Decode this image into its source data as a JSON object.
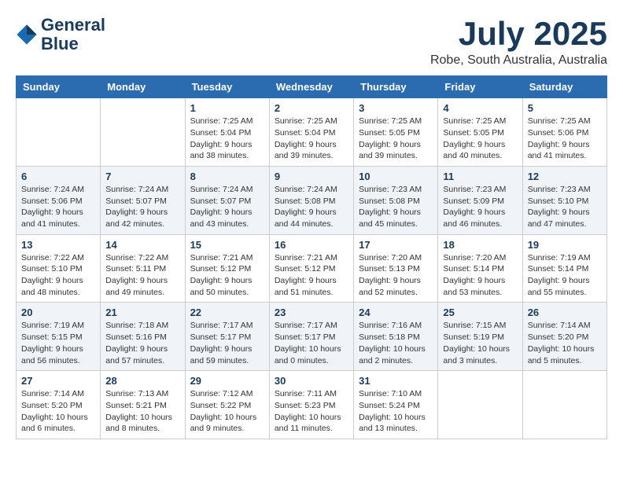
{
  "header": {
    "logo_line1": "General",
    "logo_line2": "Blue",
    "title": "July 2025",
    "subtitle": "Robe, South Australia, Australia"
  },
  "weekdays": [
    "Sunday",
    "Monday",
    "Tuesday",
    "Wednesday",
    "Thursday",
    "Friday",
    "Saturday"
  ],
  "weeks": [
    [
      {
        "day": "",
        "info": ""
      },
      {
        "day": "",
        "info": ""
      },
      {
        "day": "1",
        "info": "Sunrise: 7:25 AM\nSunset: 5:04 PM\nDaylight: 9 hours\nand 38 minutes."
      },
      {
        "day": "2",
        "info": "Sunrise: 7:25 AM\nSunset: 5:04 PM\nDaylight: 9 hours\nand 39 minutes."
      },
      {
        "day": "3",
        "info": "Sunrise: 7:25 AM\nSunset: 5:05 PM\nDaylight: 9 hours\nand 39 minutes."
      },
      {
        "day": "4",
        "info": "Sunrise: 7:25 AM\nSunset: 5:05 PM\nDaylight: 9 hours\nand 40 minutes."
      },
      {
        "day": "5",
        "info": "Sunrise: 7:25 AM\nSunset: 5:06 PM\nDaylight: 9 hours\nand 41 minutes."
      }
    ],
    [
      {
        "day": "6",
        "info": "Sunrise: 7:24 AM\nSunset: 5:06 PM\nDaylight: 9 hours\nand 41 minutes."
      },
      {
        "day": "7",
        "info": "Sunrise: 7:24 AM\nSunset: 5:07 PM\nDaylight: 9 hours\nand 42 minutes."
      },
      {
        "day": "8",
        "info": "Sunrise: 7:24 AM\nSunset: 5:07 PM\nDaylight: 9 hours\nand 43 minutes."
      },
      {
        "day": "9",
        "info": "Sunrise: 7:24 AM\nSunset: 5:08 PM\nDaylight: 9 hours\nand 44 minutes."
      },
      {
        "day": "10",
        "info": "Sunrise: 7:23 AM\nSunset: 5:08 PM\nDaylight: 9 hours\nand 45 minutes."
      },
      {
        "day": "11",
        "info": "Sunrise: 7:23 AM\nSunset: 5:09 PM\nDaylight: 9 hours\nand 46 minutes."
      },
      {
        "day": "12",
        "info": "Sunrise: 7:23 AM\nSunset: 5:10 PM\nDaylight: 9 hours\nand 47 minutes."
      }
    ],
    [
      {
        "day": "13",
        "info": "Sunrise: 7:22 AM\nSunset: 5:10 PM\nDaylight: 9 hours\nand 48 minutes."
      },
      {
        "day": "14",
        "info": "Sunrise: 7:22 AM\nSunset: 5:11 PM\nDaylight: 9 hours\nand 49 minutes."
      },
      {
        "day": "15",
        "info": "Sunrise: 7:21 AM\nSunset: 5:12 PM\nDaylight: 9 hours\nand 50 minutes."
      },
      {
        "day": "16",
        "info": "Sunrise: 7:21 AM\nSunset: 5:12 PM\nDaylight: 9 hours\nand 51 minutes."
      },
      {
        "day": "17",
        "info": "Sunrise: 7:20 AM\nSunset: 5:13 PM\nDaylight: 9 hours\nand 52 minutes."
      },
      {
        "day": "18",
        "info": "Sunrise: 7:20 AM\nSunset: 5:14 PM\nDaylight: 9 hours\nand 53 minutes."
      },
      {
        "day": "19",
        "info": "Sunrise: 7:19 AM\nSunset: 5:14 PM\nDaylight: 9 hours\nand 55 minutes."
      }
    ],
    [
      {
        "day": "20",
        "info": "Sunrise: 7:19 AM\nSunset: 5:15 PM\nDaylight: 9 hours\nand 56 minutes."
      },
      {
        "day": "21",
        "info": "Sunrise: 7:18 AM\nSunset: 5:16 PM\nDaylight: 9 hours\nand 57 minutes."
      },
      {
        "day": "22",
        "info": "Sunrise: 7:17 AM\nSunset: 5:17 PM\nDaylight: 9 hours\nand 59 minutes."
      },
      {
        "day": "23",
        "info": "Sunrise: 7:17 AM\nSunset: 5:17 PM\nDaylight: 10 hours\nand 0 minutes."
      },
      {
        "day": "24",
        "info": "Sunrise: 7:16 AM\nSunset: 5:18 PM\nDaylight: 10 hours\nand 2 minutes."
      },
      {
        "day": "25",
        "info": "Sunrise: 7:15 AM\nSunset: 5:19 PM\nDaylight: 10 hours\nand 3 minutes."
      },
      {
        "day": "26",
        "info": "Sunrise: 7:14 AM\nSunset: 5:20 PM\nDaylight: 10 hours\nand 5 minutes."
      }
    ],
    [
      {
        "day": "27",
        "info": "Sunrise: 7:14 AM\nSunset: 5:20 PM\nDaylight: 10 hours\nand 6 minutes."
      },
      {
        "day": "28",
        "info": "Sunrise: 7:13 AM\nSunset: 5:21 PM\nDaylight: 10 hours\nand 8 minutes."
      },
      {
        "day": "29",
        "info": "Sunrise: 7:12 AM\nSunset: 5:22 PM\nDaylight: 10 hours\nand 9 minutes."
      },
      {
        "day": "30",
        "info": "Sunrise: 7:11 AM\nSunset: 5:23 PM\nDaylight: 10 hours\nand 11 minutes."
      },
      {
        "day": "31",
        "info": "Sunrise: 7:10 AM\nSunset: 5:24 PM\nDaylight: 10 hours\nand 13 minutes."
      },
      {
        "day": "",
        "info": ""
      },
      {
        "day": "",
        "info": ""
      }
    ]
  ]
}
